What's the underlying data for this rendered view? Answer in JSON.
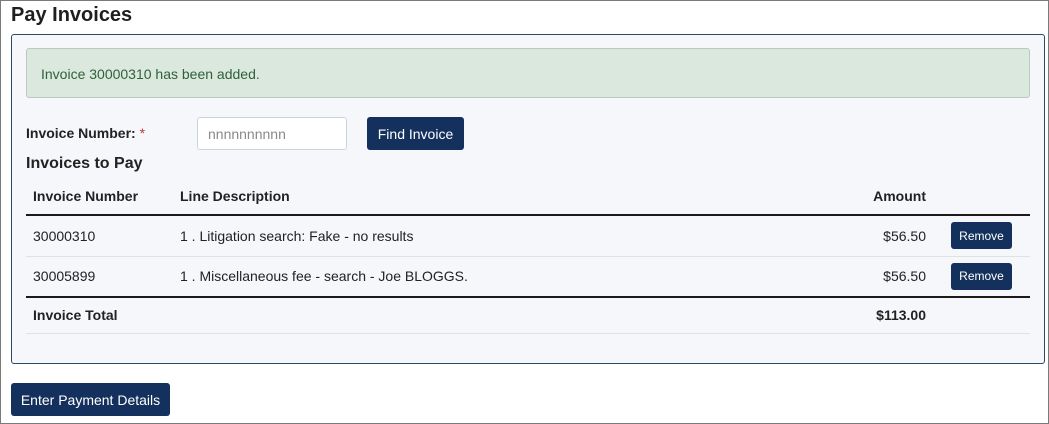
{
  "page": {
    "title": "Pay Invoices"
  },
  "alert": {
    "message": "Invoice 30000310 has been added."
  },
  "search": {
    "label": "Invoice Number:",
    "required_marker": "*",
    "placeholder": "nnnnnnnnnn",
    "button_label": "Find Invoice"
  },
  "invoices": {
    "heading": "Invoices to Pay",
    "columns": {
      "number": "Invoice Number",
      "description": "Line Description",
      "amount": "Amount"
    },
    "rows": [
      {
        "number": "30000310",
        "description": "1 . Litigation search: Fake - no results",
        "amount": "$56.50",
        "action": "Remove"
      },
      {
        "number": "30005899",
        "description": "1 . Miscellaneous fee - search - Joe BLOGGS.",
        "amount": "$56.50",
        "action": "Remove"
      }
    ],
    "total_label": "Invoice Total",
    "total_amount": "$113.00"
  },
  "footer": {
    "button_label": "Enter Payment Details"
  },
  "colors": {
    "primary_button": "#13315c",
    "alert_background": "#dbe8de",
    "alert_text": "#2f5f3b",
    "panel_border": "#2b4a66"
  }
}
